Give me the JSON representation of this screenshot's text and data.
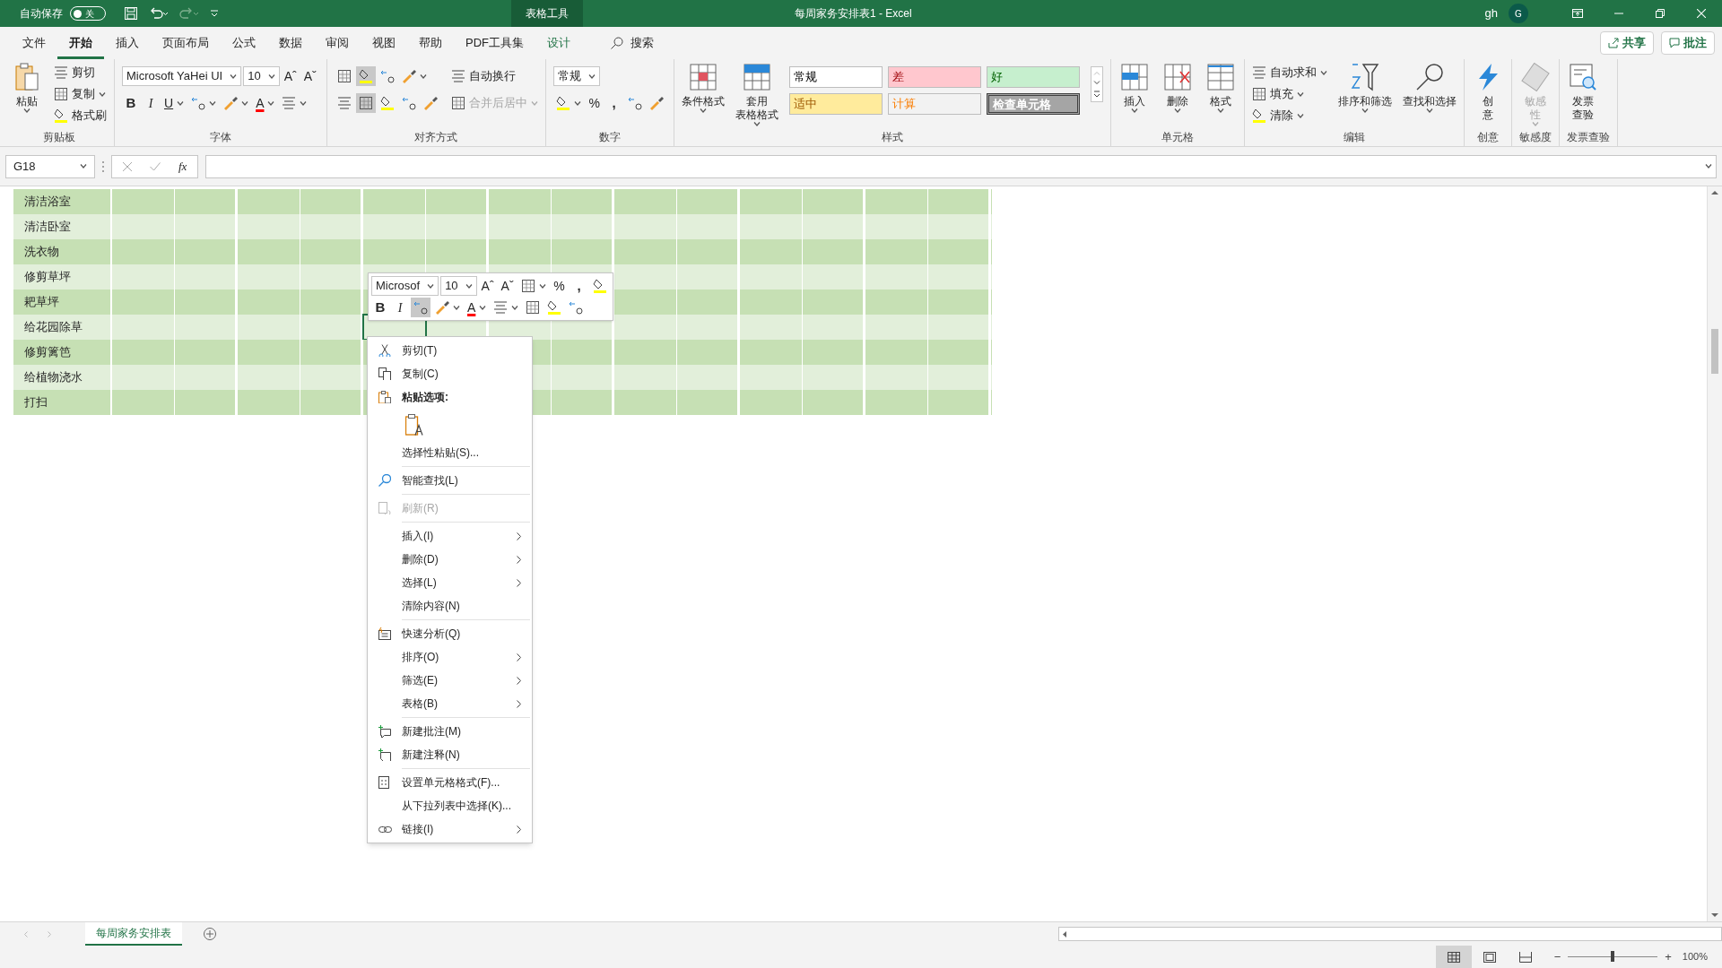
{
  "title_bar": {
    "autosave_label": "自动保存",
    "autosave_state": "关",
    "autosave_on": false,
    "context_tab": "表格工具",
    "title": "每周家务安排表1  -  Excel",
    "user": "gh",
    "avatar": "G"
  },
  "tabs": [
    {
      "label": "文件",
      "selected": false,
      "kind": "normal"
    },
    {
      "label": "开始",
      "selected": true,
      "kind": "normal"
    },
    {
      "label": "插入",
      "selected": false,
      "kind": "normal"
    },
    {
      "label": "页面布局",
      "selected": false,
      "kind": "normal"
    },
    {
      "label": "公式",
      "selected": false,
      "kind": "normal"
    },
    {
      "label": "数据",
      "selected": false,
      "kind": "normal"
    },
    {
      "label": "审阅",
      "selected": false,
      "kind": "normal"
    },
    {
      "label": "视图",
      "selected": false,
      "kind": "normal"
    },
    {
      "label": "帮助",
      "selected": false,
      "kind": "normal"
    },
    {
      "label": "PDF工具集",
      "selected": false,
      "kind": "normal"
    },
    {
      "label": "设计",
      "selected": false,
      "kind": "contextual"
    }
  ],
  "search": {
    "label": "搜索"
  },
  "share_button": "共享",
  "comments_button": "批注",
  "ribbon": {
    "groups": [
      {
        "label": "剪贴板",
        "columns": [
          {
            "kind": "large",
            "lines": [
              "粘贴"
            ],
            "caret": true
          },
          {
            "kind": "stack",
            "rows": [
              {
                "items": [
                  {
                    "kind": "small",
                    "label": "剪切"
                  }
                ]
              },
              {
                "items": [
                  {
                    "kind": "small",
                    "label": "复制",
                    "caret": true
                  }
                ]
              },
              {
                "items": [
                  {
                    "kind": "small",
                    "label": "格式刷"
                  }
                ]
              }
            ]
          }
        ]
      },
      {
        "label": "字体",
        "columns": [
          {
            "kind": "stack",
            "rows": [
              {
                "items": [
                  {
                    "kind": "field",
                    "value": "Microsoft YaHei UI"
                  },
                  {
                    "kind": "field",
                    "value": "10"
                  },
                  {
                    "kind": "glyph",
                    "text": "Aˆ"
                  },
                  {
                    "kind": "glyph",
                    "text": "Aˇ"
                  }
                ]
              },
              {
                "items": [
                  {
                    "kind": "bold",
                    "text": "B"
                  },
                  {
                    "kind": "italic",
                    "text": "I"
                  },
                  {
                    "kind": "underline",
                    "text": "U",
                    "caret": true
                  },
                  {
                    "kind": "icon",
                    "caret": true
                  },
                  {
                    "kind": "icon",
                    "caret": true
                  },
                  {
                    "kind": "fontcolor",
                    "text": "A",
                    "caret": true
                  },
                  {
                    "kind": "icon",
                    "caret": true
                  }
                ]
              }
            ]
          }
        ]
      },
      {
        "label": "对齐方式",
        "columns": [
          {
            "kind": "stack",
            "rows": [
              {
                "items": [
                  {
                    "kind": "icon",
                    "selected": false
                  },
                  {
                    "kind": "icon",
                    "selected": true
                  },
                  {
                    "kind": "icon",
                    "selected": false
                  },
                  {
                    "kind": "icon",
                    "caret": true
                  }
                ]
              },
              {
                "items": [
                  {
                    "kind": "icon",
                    "selected": false
                  },
                  {
                    "kind": "icon",
                    "selected": true
                  },
                  {
                    "kind": "icon",
                    "selected": false
                  },
                  {
                    "kind": "icon"
                  },
                  {
                    "kind": "icon"
                  }
                ]
              }
            ]
          },
          {
            "kind": "stack",
            "rows": [
              {
                "items": [
                  {
                    "kind": "small",
                    "label": "自动换行"
                  }
                ]
              },
              {
                "items": [
                  {
                    "kind": "small",
                    "label": "合并后居中",
                    "caret": true,
                    "disabled": true
                  }
                ]
              }
            ]
          }
        ]
      },
      {
        "label": "数字",
        "columns": [
          {
            "kind": "stack",
            "rows": [
              {
                "items": [
                  {
                    "kind": "field",
                    "value": "常规"
                  }
                ]
              },
              {
                "items": [
                  {
                    "kind": "icon",
                    "caret": true
                  },
                  {
                    "kind": "glyph",
                    "text": "%"
                  },
                  {
                    "kind": "bold",
                    "text": ","
                  },
                  {
                    "kind": "icon"
                  },
                  {
                    "kind": "icon"
                  }
                ]
              }
            ]
          }
        ]
      },
      {
        "label": "样式",
        "columns": [
          {
            "kind": "large",
            "lines": [
              "条件格式"
            ],
            "caret": true
          },
          {
            "kind": "large",
            "lines": [
              "套用",
              "表格格式"
            ],
            "caret": true
          },
          {
            "kind": "styles",
            "cells": [
              {
                "label": "常规",
                "color": "#ffffff"
              },
              {
                "label": "差",
                "color": "#ffc7ce"
              },
              {
                "label": "好",
                "color": "#c6efce"
              },
              {
                "label": "适中",
                "color": "#ffeb9c"
              },
              {
                "label": "计算",
                "color": "#f2f2f2"
              },
              {
                "label": "检查单元格",
                "color": "#a5a5a5"
              }
            ]
          }
        ]
      },
      {
        "label": "单元格",
        "columns": [
          {
            "kind": "large",
            "lines": [
              "插入"
            ],
            "caret": true
          },
          {
            "kind": "large",
            "lines": [
              "删除"
            ],
            "caret": true
          },
          {
            "kind": "large",
            "lines": [
              "格式"
            ],
            "caret": true
          }
        ]
      },
      {
        "label": "编辑",
        "columns": [
          {
            "kind": "stack",
            "rows": [
              {
                "items": [
                  {
                    "kind": "small",
                    "label": "自动求和",
                    "caret": true
                  }
                ]
              },
              {
                "items": [
                  {
                    "kind": "small",
                    "label": "填充",
                    "caret": true
                  }
                ]
              },
              {
                "items": [
                  {
                    "kind": "small",
                    "label": "清除",
                    "caret": true
                  }
                ]
              }
            ]
          },
          {
            "kind": "large",
            "lines": [
              "排序和筛选"
            ],
            "caret": true
          },
          {
            "kind": "large",
            "lines": [
              "查找和选择"
            ],
            "caret": true
          }
        ]
      },
      {
        "label": "创意",
        "columns": [
          {
            "kind": "large",
            "lines": [
              "创",
              "意"
            ]
          }
        ]
      },
      {
        "label": "敏感度",
        "columns": [
          {
            "kind": "large",
            "lines": [
              "敏感",
              "性"
            ],
            "caret": true,
            "disabled": true
          }
        ]
      },
      {
        "label": "发票查验",
        "columns": [
          {
            "kind": "large",
            "lines": [
              "发票",
              "查验"
            ]
          }
        ]
      }
    ]
  },
  "formula_bar": {
    "name_box": "G18",
    "fx": "fx"
  },
  "sheet": {
    "rows": [
      {
        "label": "清洁浴室",
        "selected": false
      },
      {
        "label": "清洁卧室",
        "selected": false
      },
      {
        "label": "洗衣物",
        "selected": false
      },
      {
        "label": "修剪草坪",
        "selected": false
      },
      {
        "label": "耙草坪",
        "selected": false
      },
      {
        "label": "给花园除草",
        "selected": true
      },
      {
        "label": "修剪篱笆",
        "selected": false
      },
      {
        "label": "给植物浇水",
        "selected": false
      },
      {
        "label": "打扫",
        "selected": false
      }
    ]
  },
  "mini_toolbar": {
    "rows": [
      {
        "items": [
          {
            "kind": "field",
            "value": "Microsof"
          },
          {
            "kind": "field",
            "value": "10"
          },
          {
            "kind": "glyph",
            "text": "Aˆ"
          },
          {
            "kind": "glyph",
            "text": "Aˇ"
          },
          {
            "kind": "icon",
            "caret": true
          },
          {
            "kind": "glyph",
            "text": "%"
          },
          {
            "kind": "bold",
            "text": ","
          },
          {
            "kind": "icon"
          }
        ]
      },
      {
        "items": [
          {
            "kind": "bold",
            "text": "B"
          },
          {
            "kind": "italic",
            "text": "I"
          },
          {
            "kind": "icon",
            "selected": true
          },
          {
            "kind": "icon",
            "caret": true,
            "selected": false
          },
          {
            "kind": "fontcolor",
            "text": "A",
            "caret": true
          },
          {
            "kind": "icon",
            "caret": true,
            "selected": false
          },
          {
            "kind": "icon",
            "selected": false
          },
          {
            "kind": "icon",
            "selected": false
          },
          {
            "kind": "icon",
            "selected": false
          }
        ]
      }
    ]
  },
  "context_menu": [
    {
      "kind": "item",
      "label": "剪切(T)",
      "has_icon": true,
      "disabled": false,
      "separator": false
    },
    {
      "kind": "item",
      "label": "复制(C)",
      "has_icon": true,
      "disabled": false,
      "separator": false
    },
    {
      "kind": "header",
      "label": "粘贴选项:",
      "has_icon": true,
      "disabled": false,
      "separator": false
    },
    {
      "kind": "paste-option",
      "has_icon": true,
      "disabled": false,
      "separator": false
    },
    {
      "kind": "item",
      "label": "选择性粘贴(S)...",
      "has_icon": false,
      "disabled": false,
      "separator": false
    },
    {
      "kind": "item",
      "label": "智能查找(L)",
      "has_icon": true,
      "disabled": false,
      "separator": true
    },
    {
      "kind": "item",
      "label": "刷新(R)",
      "has_icon": true,
      "disabled": true,
      "separator": true
    },
    {
      "kind": "submenu",
      "label": "插入(I)",
      "has_icon": false,
      "disabled": false,
      "separator": true
    },
    {
      "kind": "submenu",
      "label": "删除(D)",
      "has_icon": false,
      "disabled": false,
      "separator": false
    },
    {
      "kind": "submenu",
      "label": "选择(L)",
      "has_icon": false,
      "disabled": false,
      "separator": false
    },
    {
      "kind": "item",
      "label": "清除内容(N)",
      "has_icon": false,
      "disabled": false,
      "separator": false
    },
    {
      "kind": "item",
      "label": "快速分析(Q)",
      "has_icon": true,
      "disabled": false,
      "separator": true
    },
    {
      "kind": "submenu",
      "label": "排序(O)",
      "has_icon": false,
      "disabled": false,
      "separator": false
    },
    {
      "kind": "submenu",
      "label": "筛选(E)",
      "has_icon": false,
      "disabled": false,
      "separator": false
    },
    {
      "kind": "submenu",
      "label": "表格(B)",
      "has_icon": false,
      "disabled": false,
      "separator": false
    },
    {
      "kind": "item",
      "label": "新建批注(M)",
      "has_icon": true,
      "disabled": false,
      "separator": true
    },
    {
      "kind": "item",
      "label": "新建注释(N)",
      "has_icon": true,
      "disabled": false,
      "separator": false
    },
    {
      "kind": "item",
      "label": "设置单元格格式(F)...",
      "has_icon": true,
      "disabled": false,
      "separator": true
    },
    {
      "kind": "item",
      "label": "从下拉列表中选择(K)...",
      "has_icon": false,
      "disabled": false,
      "separator": false
    },
    {
      "kind": "submenu",
      "label": "链接(I)",
      "has_icon": true,
      "disabled": false,
      "separator": false
    }
  ],
  "sheet_tabs": [
    {
      "label": "每周家务安排表",
      "selected": true
    }
  ],
  "status_bar": {
    "views": [
      {
        "selected": true
      },
      {
        "selected": false
      },
      {
        "selected": false
      }
    ],
    "zoom_out": "−",
    "zoom_in": "+",
    "zoom": "100%",
    "zoom_level": {
      "level": 0.5
    }
  }
}
